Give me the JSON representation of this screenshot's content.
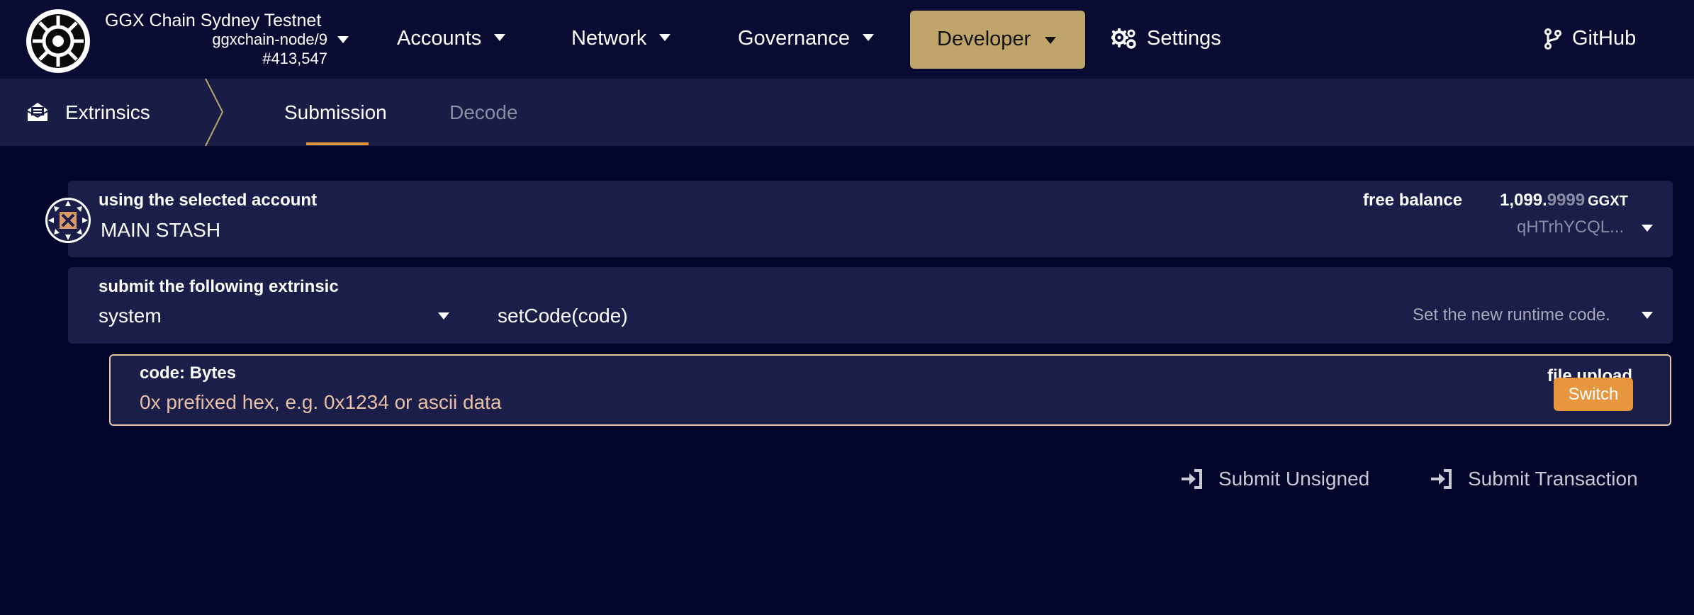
{
  "app": {
    "chain_name": "GGX Chain Sydney Testnet",
    "node": "ggxchain-node/9",
    "block": "#413,547"
  },
  "nav": {
    "accounts": "Accounts",
    "network": "Network",
    "governance": "Governance",
    "developer": "Developer",
    "settings": "Settings",
    "github": "GitHub"
  },
  "subnav": {
    "title": "Extrinsics",
    "tabs": [
      "Submission",
      "Decode"
    ],
    "active_tab": "Submission"
  },
  "account": {
    "label": "using the selected account",
    "name": "MAIN STASH",
    "balance_label": "free balance",
    "balance_int": "1,099.",
    "balance_dec": "9999",
    "balance_unit": "GGXT",
    "address": "qHTrhYCQL..."
  },
  "extrinsic": {
    "label": "submit the following extrinsic",
    "section": "system",
    "method": "setCode(code)",
    "description": "Set the new runtime code."
  },
  "param": {
    "label": "code: Bytes",
    "placeholder": "0x prefixed hex, e.g. 0x1234 or ascii data",
    "file_upload_label": "file upload",
    "switch_label": "Switch"
  },
  "actions": {
    "submit_unsigned": "Submit Unsigned",
    "submit_transaction": "Submit Transaction"
  },
  "colors": {
    "background": "#03042a",
    "topbar": "#090b33",
    "panel": "#1b1e48",
    "accent": "#e8963e",
    "developer_active": "#c0a56a"
  }
}
